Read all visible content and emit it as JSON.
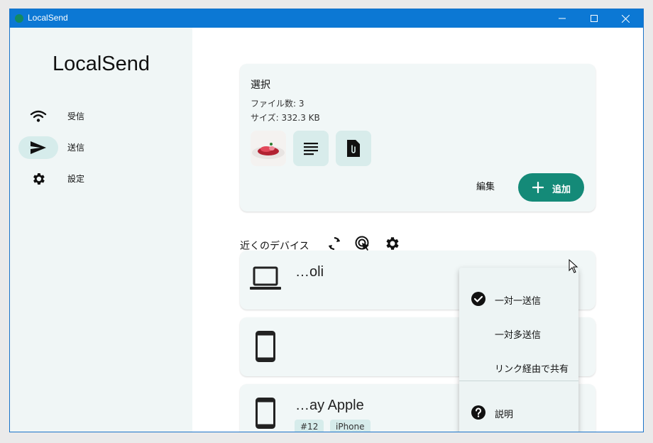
{
  "window": {
    "title": "LocalSend"
  },
  "sidebar": {
    "logo": "LocalSend",
    "items": [
      {
        "label": "受信",
        "icon": "wifi-icon"
      },
      {
        "label": "送信",
        "icon": "send-icon",
        "active": true
      },
      {
        "label": "設定",
        "icon": "gear-icon"
      }
    ]
  },
  "selection": {
    "title": "選択",
    "file_count": "ファイル数: 3",
    "size": "サイズ: 332.3 KB",
    "thumbnails": [
      "food-photo-thumbnail",
      "text-file-icon",
      "attachment-file-icon"
    ],
    "edit_label": "編集",
    "add_label": "追加"
  },
  "nearby": {
    "label": "近くのデバイス",
    "devices": [
      {
        "name": "…oli",
        "icon": "laptop-icon",
        "tags": []
      },
      {
        "name": "",
        "icon": "phone-icon",
        "tags": []
      },
      {
        "name": "…ay Apple",
        "icon": "phone-icon",
        "tags": [
          "#12",
          "iPhone"
        ]
      }
    ]
  },
  "menu": {
    "items": [
      {
        "label": "一対一送信",
        "checked": true
      },
      {
        "label": "一対多送信",
        "checked": false
      },
      {
        "label": "リンク経由で共有",
        "checked": false
      }
    ],
    "help_label": "説明"
  },
  "colors": {
    "accent": "#148a78",
    "titlebar": "#0c78d4",
    "sidebar_bg": "#f0f6f6",
    "card_bg": "#f1f7f7"
  }
}
